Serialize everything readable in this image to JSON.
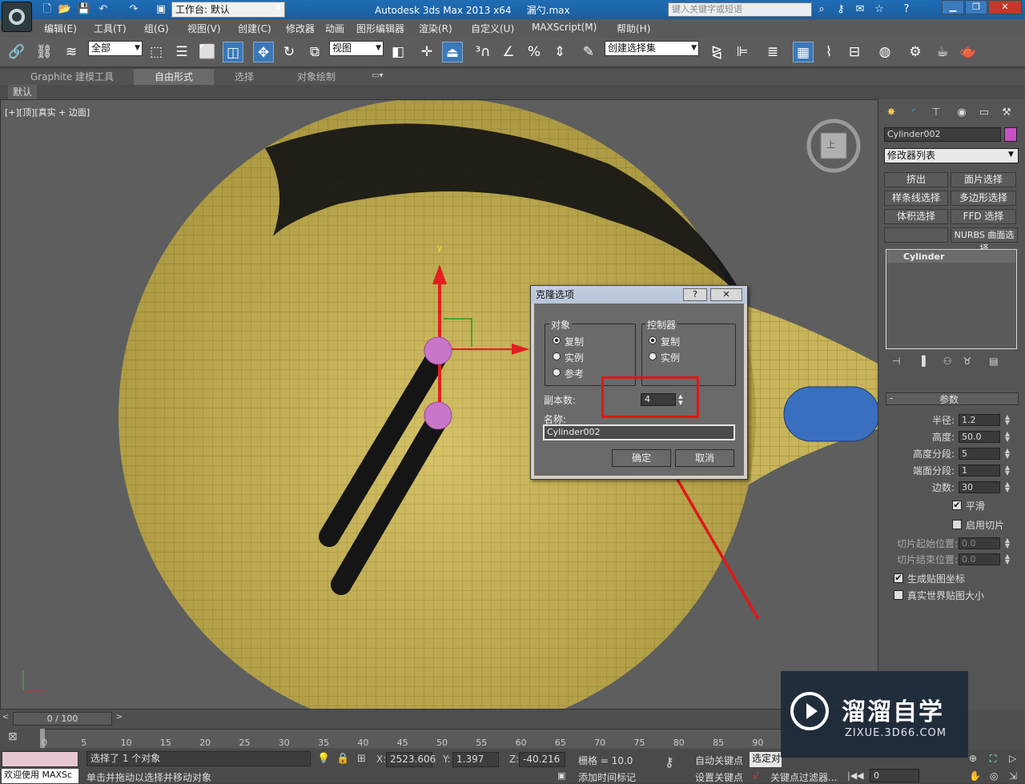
{
  "titlebar": {
    "workspace_label": "工作台: 默认",
    "app_title": "Autodesk 3ds Max  2013 x64",
    "file_name": "漏勺.max",
    "search_placeholder": "键入关键字或短语"
  },
  "menu": [
    "编辑(E)",
    "工具(T)",
    "组(G)",
    "视图(V)",
    "创建(C)",
    "修改器",
    "动画",
    "图形编辑器",
    "渲染(R)",
    "自定义(U)",
    "MAXScript(M)",
    "帮助(H)"
  ],
  "toolbar": {
    "selection_filter": "全部",
    "ref_coord": "视图",
    "named_selection": "创建选择集"
  },
  "ribbon": {
    "tabs": [
      "Graphite 建模工具",
      "自由形式",
      "选择",
      "对象绘制"
    ],
    "active_tab": "自由形式",
    "sub_label": "默认"
  },
  "viewport": {
    "label": "[+][顶][真实 + 边面]",
    "viewcube_label": "上"
  },
  "dialog": {
    "title": "克隆选项",
    "help": "?",
    "close": "✕",
    "object_group": "对象",
    "object_options": [
      "复制",
      "实例",
      "参考"
    ],
    "controller_group": "控制器",
    "controller_options": [
      "复制",
      "实例"
    ],
    "copies_label": "副本数:",
    "copies_value": "4",
    "name_label": "名称:",
    "name_value": "Cylinder002",
    "ok": "确定",
    "cancel": "取消"
  },
  "command_panel": {
    "object_name": "Cylinder002",
    "object_color": "#c850c8",
    "modifier_list": "修改器列表",
    "modifier_buttons": [
      "挤出",
      "面片选择",
      "样条线选择",
      "多边形选择",
      "体积选择",
      "FFD 选择",
      "",
      "NURBS 曲面选择"
    ],
    "stack_item": "Cylinder",
    "rollout_title": "参数",
    "params": [
      {
        "label": "半径:",
        "value": "1.2"
      },
      {
        "label": "高度:",
        "value": "50.0"
      },
      {
        "label": "高度分段:",
        "value": "5"
      },
      {
        "label": "端面分段:",
        "value": "1"
      },
      {
        "label": "边数:",
        "value": "30"
      }
    ],
    "smooth": "平滑",
    "enable_slice": "启用切片",
    "slice_from_label": "切片起始位置:",
    "slice_from": "0.0",
    "slice_to_label": "切片结束位置:",
    "slice_to": "0.0",
    "gen_mapping": "生成贴图坐标",
    "real_world": "真实世界贴图大小"
  },
  "timeline": {
    "frame": "0 / 100",
    "ticks": [
      "0",
      "5",
      "10",
      "15",
      "20",
      "25",
      "30",
      "35",
      "40",
      "45",
      "50",
      "55",
      "60",
      "65",
      "70",
      "75",
      "80",
      "85",
      "90"
    ]
  },
  "status": {
    "selected": "选择了 1 个对象",
    "hint": "单击并拖动以选择并移动对象",
    "welcome": "欢迎使用 MAXSc",
    "x_label": "X:",
    "x": "2523.606",
    "y_label": "Y:",
    "y": "1.397",
    "z_label": "Z:",
    "z": "-40.216",
    "grid": "栅格 = 10.0",
    "auto_key": "自动关键点",
    "set_key": "设置关键点",
    "selected_obj": "选定对",
    "key_filters": "关键点过滤器...",
    "add_time_tag": "添加时间标记",
    "frame_field": "0"
  },
  "watermark": {
    "brand": "溜溜自学",
    "url": "ZIXUE.3D66.COM"
  }
}
